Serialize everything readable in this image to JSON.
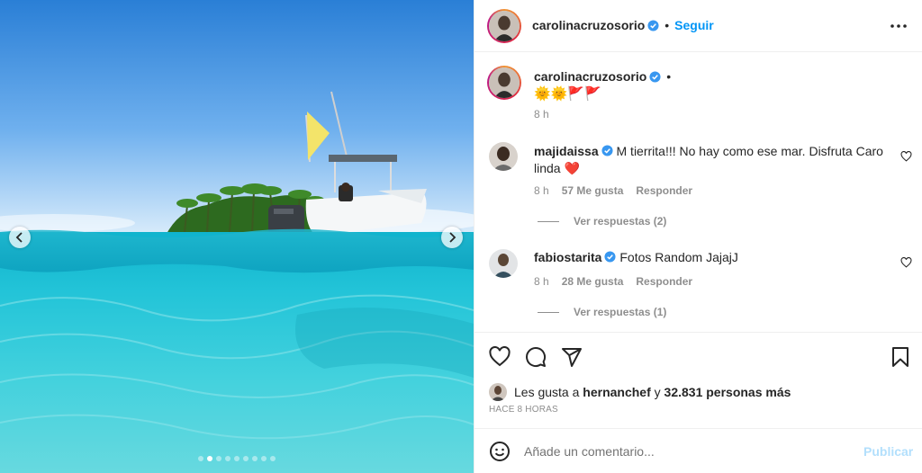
{
  "post": {
    "carousel": {
      "slide_count": 9,
      "active_index": 1
    }
  },
  "header": {
    "username": "carolinacruzosorio",
    "separator": "•",
    "follow_label": "Seguir"
  },
  "caption": {
    "username": "carolinacruzosorio",
    "separator": "•",
    "emoji_text": "🌞🌞🚩🚩",
    "time": "8 h"
  },
  "comments": [
    {
      "username": "majidaissa",
      "text": "M tierrita!!! No hay como ese mar. Disfruta Caro linda ❤️",
      "time": "8 h",
      "likes": "57 Me gusta",
      "reply_label": "Responder",
      "view_replies": "Ver respuestas (2)"
    },
    {
      "username": "fabiostarita",
      "text": "Fotos Random JajajJ",
      "time": "8 h",
      "likes": "28 Me gusta",
      "reply_label": "Responder",
      "view_replies": "Ver respuestas (1)"
    }
  ],
  "likes": {
    "prefix": "Les gusta a",
    "user": "hernanchef",
    "conj": "y",
    "others": "32.831 personas más"
  },
  "time_ago": "HACE 8 HORAS",
  "add_comment": {
    "placeholder": "Añade un comentario...",
    "publish_label": "Publicar"
  },
  "icons": {
    "verified": "verified-badge-icon",
    "like": "heart-icon",
    "comment": "comment-bubble-icon",
    "share": "paper-plane-icon",
    "save": "bookmark-icon",
    "emoji": "smiley-icon",
    "more": "more-dots-icon"
  },
  "colors": {
    "accent": "#0095f6",
    "verified": "#3897f0",
    "muted": "#8e8e8e",
    "publish_disabled": "#b2dffc"
  }
}
